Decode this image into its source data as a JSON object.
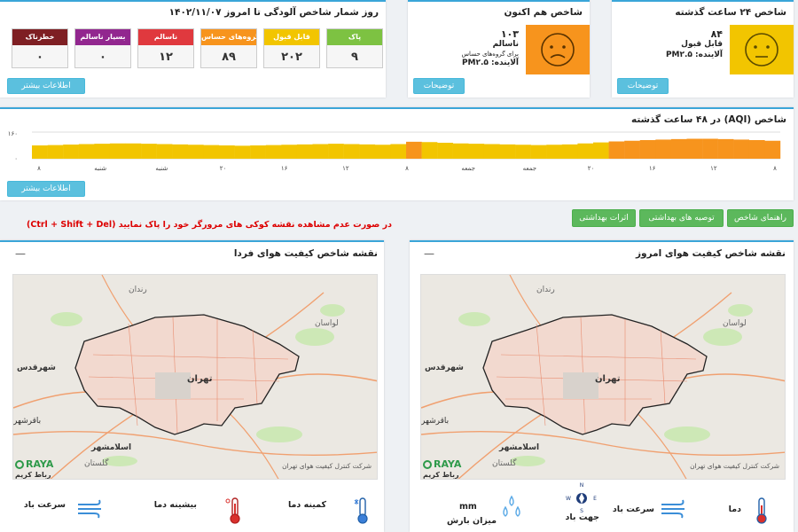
{
  "days_panel": {
    "title": "روز شمار شاخص آلودگی تا امروز ۱۴۰۲/۱۱/۰۷",
    "more_label": "اطلاعات بیشتر",
    "categories": [
      {
        "label": "پاک",
        "value": "۹",
        "color": "#7dc242"
      },
      {
        "label": "قابل قبول",
        "value": "۲۰۲",
        "color": "#f2c500"
      },
      {
        "label": "ناسالم برای گروه‌های حساس",
        "value": "۸۹",
        "color": "#f7941d"
      },
      {
        "label": "ناسالم",
        "value": "۱۲",
        "color": "#e0393e"
      },
      {
        "label": "بسیار ناسالم",
        "value": "۰",
        "color": "#92278f"
      },
      {
        "label": "خطرناک",
        "value": "۰",
        "color": "#7e1f23"
      }
    ]
  },
  "now_panel": {
    "title": "شاخص هم اکنون",
    "value": "۱۰۳",
    "status": "ناسالم",
    "sub": "برای گروه‌های حساس",
    "pollutant": "آلاینده: PM۲.۵",
    "button": "توضیحات",
    "color": "#f7941d"
  },
  "day_panel": {
    "title": "شاخص ۲۴ ساعت گذشته",
    "value": "۸۴",
    "status": "قابل قبول",
    "pollutant": "آلاینده: PM۲.۵",
    "button": "توضیحات",
    "color": "#f2c500"
  },
  "chart_panel": {
    "title": "شاخص (AQI) در ۴۸ ساعت گذشته",
    "more_label": "اطلاعات بیشتر"
  },
  "chart_data": {
    "type": "bar",
    "title": "شاخص (AQI) در ۴۸ ساعت گذشته",
    "ylim": [
      0,
      160
    ],
    "yticks": [
      "۰",
      "۱۶۰"
    ],
    "xticks": [
      "۸",
      "۱۲",
      "۱۶",
      "۲۰",
      "جمعه",
      "جمعه",
      "۸",
      "۱۲",
      "۱۶",
      "۲۰",
      "شنبه",
      "شنبه",
      "۸"
    ],
    "values": [
      80,
      82,
      85,
      88,
      90,
      92,
      92,
      90,
      88,
      86,
      84,
      82,
      80,
      78,
      80,
      82,
      84,
      86,
      88,
      90,
      88,
      86,
      84,
      88,
      102,
      100,
      96,
      92,
      90,
      88,
      86,
      84,
      82,
      84,
      86,
      92,
      98,
      104,
      108,
      112,
      115,
      118,
      120,
      120,
      118,
      115,
      112,
      108
    ],
    "colors": {
      "good": "#f2c500",
      "unhealthy_sensitive": "#f7941d"
    }
  },
  "nav_buttons": [
    "راهنمای شاخص",
    "توصیه های بهداشتی",
    "اثرات بهداشتی"
  ],
  "warning": "در صورت عدم مشاهده نقشه کوکی های مرورگر خود را پاک نمایید (Ctrl + Shift + Del)",
  "map_today": {
    "title": "نقشه شاخص کیفیت هوای امروز",
    "city": "تهران",
    "places": [
      "شهرقدس",
      "اسلامشهر",
      "باقرشهر",
      "لواسان",
      "رندان",
      "گلستان"
    ],
    "logo": "RAYA",
    "credit": "شرکت کنترل کیفیت هوای تهران",
    "footer": "رباط کریم"
  },
  "map_tomorrow": {
    "title": "نقشه شاخص کیفیت هوای فردا",
    "city": "تهران",
    "places": [
      "شهرقدس",
      "اسلامشهر",
      "باقرشهر",
      "لواسان",
      "رندان",
      "گلستان"
    ],
    "logo": "RAYA",
    "credit": "شرکت کنترل کیفیت هوای تهران",
    "footer": "رباط کریم"
  },
  "weather_today": {
    "temp": "دما",
    "wind_speed": "سرعت باد",
    "wind_dir": "جهت باد",
    "rain_unit": "mm",
    "rain": "میزان بارش",
    "compass": [
      "N",
      "E",
      "S",
      "W"
    ]
  },
  "weather_tomorrow": {
    "min_temp": "کمینه دما",
    "max_temp": "بیشینه دما",
    "wind_speed": "سرعت باد"
  }
}
